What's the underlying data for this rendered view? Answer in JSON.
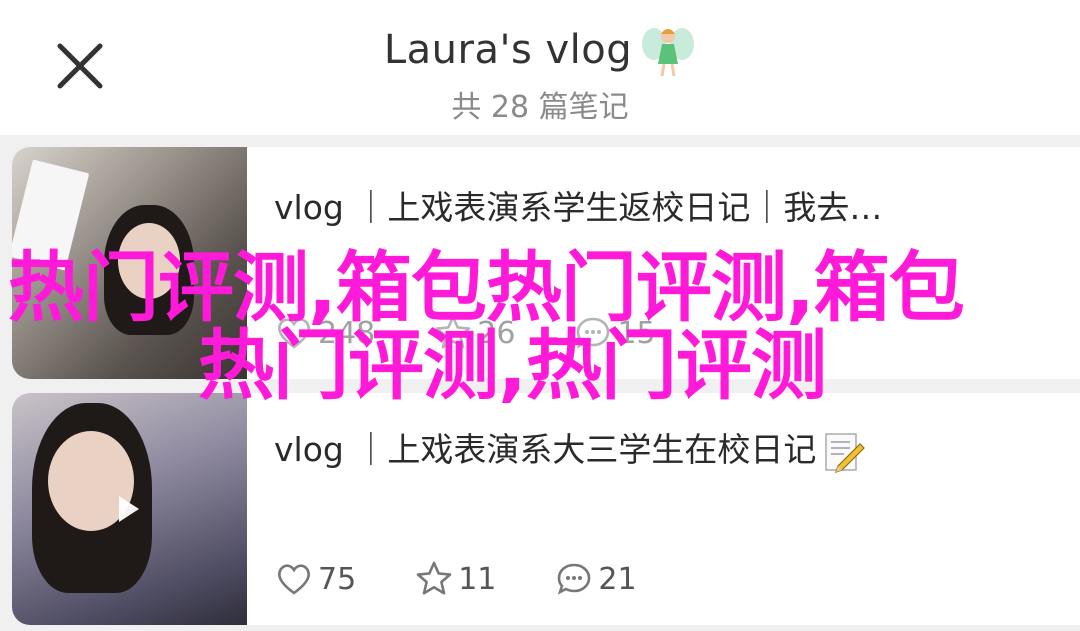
{
  "header": {
    "title": "Laura's vlog",
    "title_icon": "fairy-emoji",
    "subtitle": "共 28 篇笔记",
    "close_icon": "close-icon"
  },
  "notes": [
    {
      "title": "vlog ｜上戏表演系学生返校日记｜我去…",
      "has_video": false,
      "stats": {
        "likes": "248",
        "collects": "26",
        "comments": "15"
      }
    },
    {
      "title": "vlog ｜上戏表演系大三学生在校日记",
      "title_emoji": "memo-pencil-emoji",
      "has_video": true,
      "stats": {
        "likes": "75",
        "collects": "11",
        "comments": "21"
      }
    }
  ],
  "watermark": {
    "line1": "热门评测,箱包热门评测,箱包",
    "line2": "热门评测,热门评测",
    "color": "#ff1ad9"
  },
  "colors": {
    "background": "#f0f0f0",
    "card": "#ffffff",
    "subtitle": "#8a8a8a"
  }
}
